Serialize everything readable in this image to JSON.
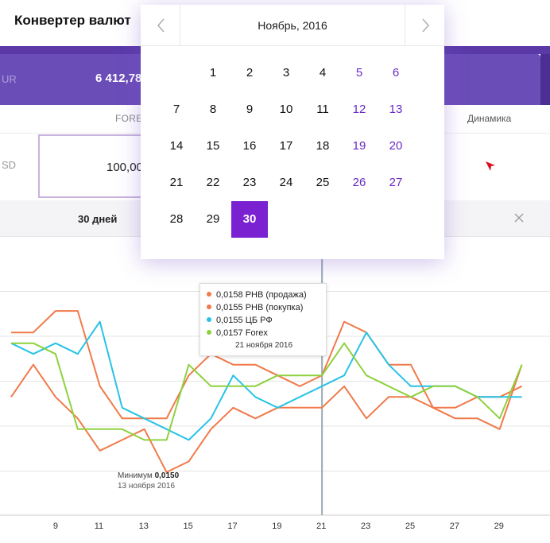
{
  "header": {
    "title": "Конвертер валют"
  },
  "rates_panel": {
    "code": "UR",
    "value": "6 412,78"
  },
  "table": {
    "col_forex": "FOREX",
    "col_dynamics": "Динамика"
  },
  "converter": {
    "currency": "SD",
    "amount": "100,00"
  },
  "period": {
    "label": "30 дней"
  },
  "calendar": {
    "month": "Ноябрь, 2016",
    "selected_day": "30",
    "weeks": [
      [
        null,
        "1",
        "2",
        "3",
        "4",
        "5",
        "6"
      ],
      [
        "7",
        "8",
        "9",
        "10",
        "11",
        "12",
        "13"
      ],
      [
        "14",
        "15",
        "16",
        "17",
        "18",
        "19",
        "20"
      ],
      [
        "21",
        "22",
        "23",
        "24",
        "25",
        "26",
        "27"
      ],
      [
        "28",
        "29",
        "30",
        null,
        null,
        null,
        null
      ]
    ]
  },
  "tooltip": {
    "rows": [
      {
        "value": "0,0158",
        "label": "РНВ (продажа)",
        "color": "#f07a4a"
      },
      {
        "value": "0,0155",
        "label": "РНВ (покупка)",
        "color": "#f07a4a"
      },
      {
        "value": "0,0155",
        "label": "ЦБ РФ",
        "color": "#27c3e6"
      },
      {
        "value": "0,0157",
        "label": "Forex",
        "color": "#8fd13f"
      }
    ],
    "date": "21 ноября 2016"
  },
  "minimum": {
    "prefix": "Минимум",
    "value": "0,0150",
    "date": "13 ноября 2016"
  },
  "chart_data": {
    "type": "line",
    "x": [
      7,
      8,
      9,
      10,
      11,
      12,
      13,
      14,
      15,
      16,
      17,
      18,
      19,
      20,
      21,
      22,
      23,
      24,
      25,
      26,
      27,
      28,
      29,
      30
    ],
    "x_ticks": [
      "9",
      "11",
      "13",
      "15",
      "17",
      "19",
      "21",
      "23",
      "25",
      "27",
      "29"
    ],
    "xlim": [
      6.5,
      30.3
    ],
    "ylim": [
      0.0146,
      0.0171
    ],
    "grid": true,
    "highlight_x": 21,
    "series": [
      {
        "name": "РНВ (продажа)",
        "color": "#f07a4a",
        "values": [
          0.0163,
          0.0163,
          0.0165,
          0.0165,
          0.0158,
          0.0155,
          0.0155,
          0.0155,
          0.0159,
          0.0161,
          0.016,
          0.016,
          0.0159,
          0.0158,
          0.0159,
          0.0164,
          0.0163,
          0.016,
          0.016,
          0.0156,
          0.0155,
          0.0155,
          0.0154,
          0.016
        ]
      },
      {
        "name": "РНВ (покупка)",
        "color": "#f07a4a",
        "values": [
          0.0157,
          0.016,
          0.0157,
          0.0155,
          0.0152,
          0.0153,
          0.0154,
          0.015,
          0.0151,
          0.0154,
          0.0156,
          0.0155,
          0.0156,
          0.0156,
          0.0156,
          0.0158,
          0.0155,
          0.0157,
          0.0157,
          0.0156,
          0.0156,
          0.0157,
          0.0157,
          0.0158
        ]
      },
      {
        "name": "ЦБ РФ",
        "color": "#27c3e6",
        "values": [
          0.0162,
          0.0161,
          0.0162,
          0.0161,
          0.0164,
          0.0156,
          0.0155,
          0.0154,
          0.0153,
          0.0155,
          0.0159,
          0.0157,
          0.0156,
          0.0157,
          0.0158,
          0.0159,
          0.0163,
          0.016,
          0.0158,
          0.0158,
          0.0158,
          0.0157,
          0.0157,
          0.0157
        ]
      },
      {
        "name": "Forex",
        "color": "#8fd13f",
        "values": [
          0.0162,
          0.0162,
          0.0161,
          0.0154,
          0.0154,
          0.0154,
          0.0153,
          0.0153,
          0.016,
          0.0158,
          0.0158,
          0.0158,
          0.0159,
          0.0159,
          0.0159,
          0.0162,
          0.0159,
          0.0158,
          0.0157,
          0.0158,
          0.0158,
          0.0157,
          0.0155,
          0.016
        ]
      }
    ]
  }
}
